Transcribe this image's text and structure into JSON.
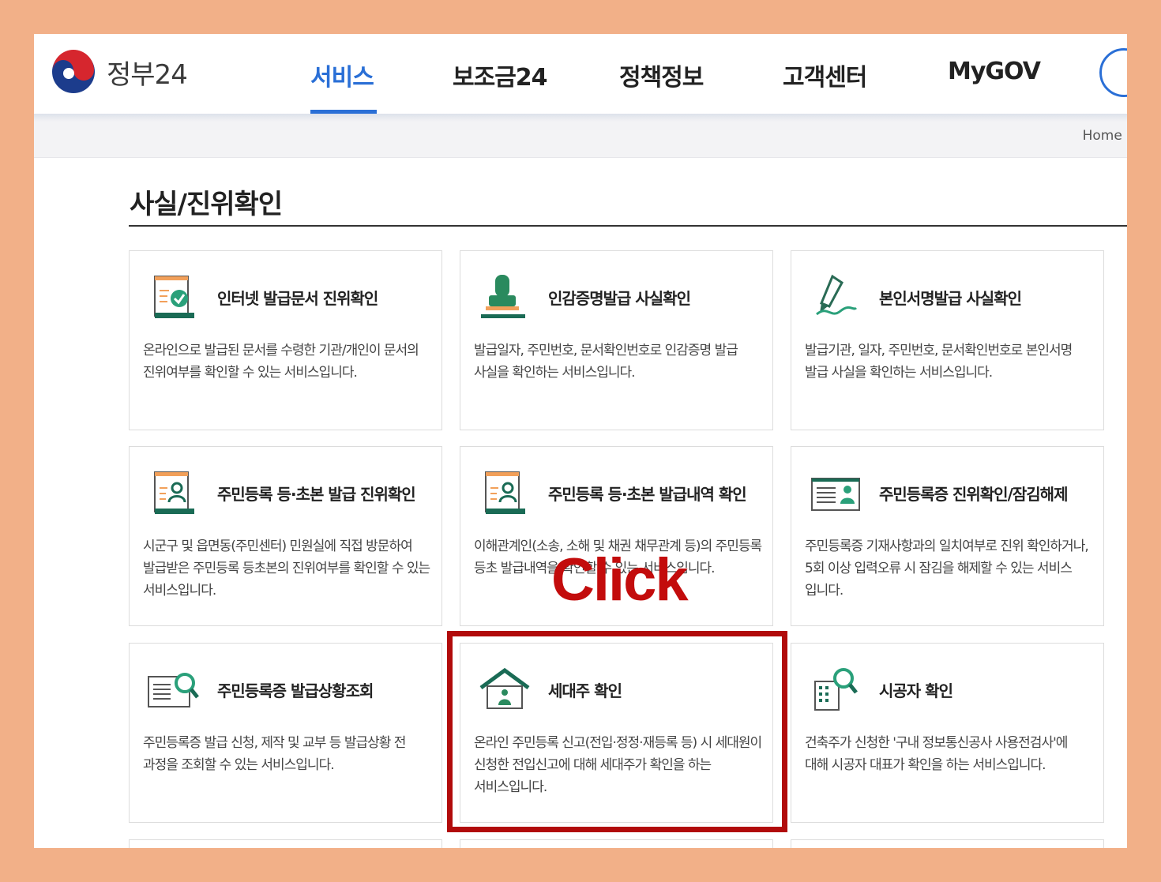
{
  "header": {
    "logo_text": "정부24",
    "nav": [
      {
        "label": "서비스",
        "active": true
      },
      {
        "label": "보조금24",
        "active": false
      },
      {
        "label": "정책정보",
        "active": false
      },
      {
        "label": "고객센터",
        "active": false
      },
      {
        "label": "MyGOV",
        "active": false
      }
    ]
  },
  "breadcrumb": {
    "home": "Home",
    "separator": "›"
  },
  "page_title": "사실/진위확인",
  "cards": [
    {
      "title": "인터넷 발급문서 진위확인",
      "desc": "온라인으로 발급된 문서를 수령한 기관/개인이 문서의 진위여부를 확인할 수 있는 서비스입니다.",
      "icon": "document-check-icon"
    },
    {
      "title": "인감증명발급 사실확인",
      "desc": "발급일자, 주민번호, 문서확인번호로 인감증명 발급 사실을 확인하는 서비스입니다.",
      "icon": "seal-stamp-icon"
    },
    {
      "title": "본인서명발급 사실확인",
      "desc": "발급기관, 일자, 주민번호, 문서확인번호로 본인서명 발급 사실을 확인하는 서비스입니다.",
      "icon": "pen-signature-icon"
    },
    {
      "title": "주민등록 등·초본 발급 진위확인",
      "desc": "시군구 및 읍면동(주민센터) 민원실에 직접 방문하여 발급받은 주민등록 등초본의 진위여부를 확인할 수 있는 서비스입니다.",
      "icon": "resident-document-icon"
    },
    {
      "title": "주민등록 등·초본 발급내역 확인",
      "desc": "이해관계인(소송, 소해 및 채권 채무관계 등)의 주민등록 등초 발급내역을 확인할 수 있는 서비스입니다.",
      "icon": "resident-document-icon"
    },
    {
      "title": "주민등록증 진위확인/잠김해제",
      "desc": "주민등록증 기재사항과의 일치여부로 진위 확인하거나, 5회 이상 입력오류 시 잠김을 해제할 수 있는 서비스 입니다.",
      "icon": "id-card-icon"
    },
    {
      "title": "주민등록증 발급상황조회",
      "desc": "주민등록증 발급 신청, 제작 및 교부 등 발급상황 전 과정을 조회할 수 있는 서비스입니다.",
      "icon": "id-card-search-icon"
    },
    {
      "title": "세대주 확인",
      "desc": "온라인 주민등록 신고(전입·정정·재등록 등) 시 세대원이 신청한 전입신고에 대해 세대주가 확인을 하는 서비스입니다.",
      "icon": "house-person-icon"
    },
    {
      "title": "시공자 확인",
      "desc": "건축주가 신청한 '구내 정보통신공사 사용전검사'에 대해 시공자 대표가 확인을 하는 서비스입니다.",
      "icon": "building-search-icon"
    }
  ],
  "annotation": {
    "click_label": "Click"
  },
  "colors": {
    "accent": "#2a6fd6",
    "icon_green": "#1a7a5e",
    "highlight_red": "#b10b0b",
    "frame_bg": "#f2b088"
  }
}
